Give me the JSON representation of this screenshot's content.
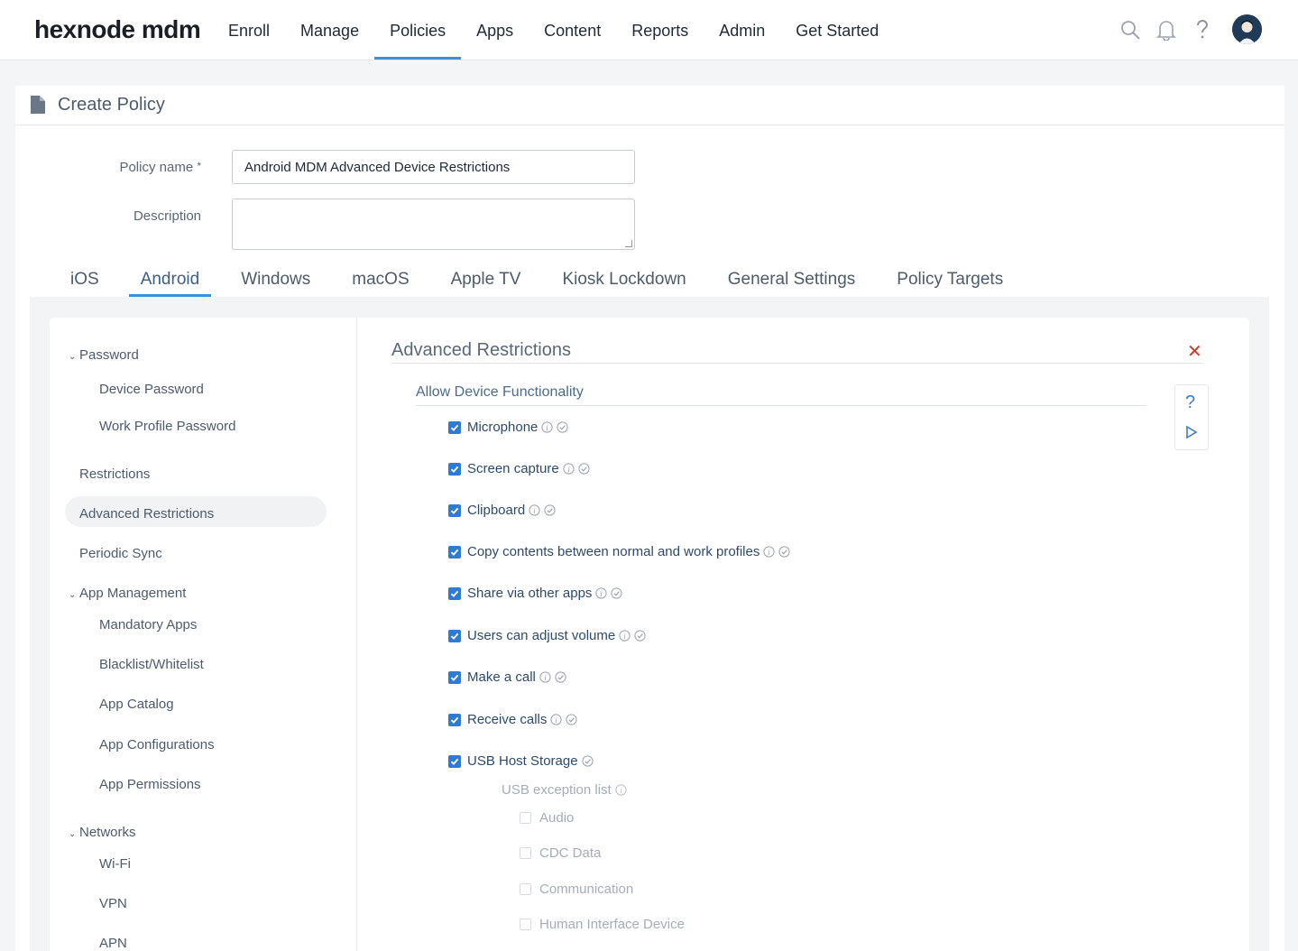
{
  "brand": {
    "logo": "hexnode mdm"
  },
  "nav": {
    "items": [
      "Enroll",
      "Manage",
      "Policies",
      "Apps",
      "Content",
      "Reports",
      "Admin",
      "Get Started"
    ],
    "active": "Policies"
  },
  "header_icons": [
    "search-icon",
    "bell-icon",
    "help-icon",
    "avatar"
  ],
  "page": {
    "title": "Create Policy"
  },
  "form": {
    "policy_name_label": "Policy name",
    "required_mark": "*",
    "policy_name_value": "Android MDM Advanced Device Restrictions",
    "description_label": "Description",
    "description_value": ""
  },
  "os_tabs": {
    "items": [
      "iOS",
      "Android",
      "Windows",
      "macOS",
      "Apple TV",
      "Kiosk Lockdown",
      "General Settings",
      "Policy Targets"
    ],
    "active": "Android"
  },
  "sidebar": {
    "password_group": "Password",
    "device_password": "Device Password",
    "work_profile_password": "Work Profile Password",
    "restrictions": "Restrictions",
    "advanced_restrictions": "Advanced Restrictions",
    "periodic_sync": "Periodic Sync",
    "app_management_group": "App Management",
    "mandatory_apps": "Mandatory Apps",
    "blacklist_whitelist": "Blacklist/Whitelist",
    "app_catalog": "App Catalog",
    "app_configurations": "App Configurations",
    "app_permissions": "App Permissions",
    "networks_group": "Networks",
    "wifi": "Wi-Fi",
    "vpn": "VPN",
    "apn": "APN",
    "active": "Advanced Restrictions"
  },
  "content": {
    "section_title": "Advanced Restrictions",
    "subsection_title": "Allow Device Functionality",
    "help_label": "?",
    "options": [
      {
        "label": "Microphone",
        "checked": true,
        "info": true
      },
      {
        "label": "Screen capture",
        "checked": true,
        "info": true
      },
      {
        "label": "Clipboard",
        "checked": true,
        "info": true
      },
      {
        "label": "Copy contents between normal and work profiles",
        "checked": true,
        "info": true
      },
      {
        "label": "Share via other apps",
        "checked": true,
        "info": true
      },
      {
        "label": "Users can adjust volume",
        "checked": true,
        "info": true
      },
      {
        "label": "Make a call",
        "checked": true,
        "info": true
      },
      {
        "label": "Receive calls",
        "checked": true,
        "info": true
      },
      {
        "label": "USB Host Storage",
        "checked": true,
        "info": false
      }
    ],
    "usb_exception_label": "USB exception list",
    "usb_exceptions": [
      {
        "label": "Audio",
        "checked": false
      },
      {
        "label": "CDC Data",
        "checked": false
      },
      {
        "label": "Communication",
        "checked": false
      },
      {
        "label": "Human Interface Device",
        "checked": false
      }
    ]
  },
  "colors": {
    "accent": "#3d8fd6",
    "checkbox": "#2f7bd3",
    "close": "#e0302a"
  }
}
